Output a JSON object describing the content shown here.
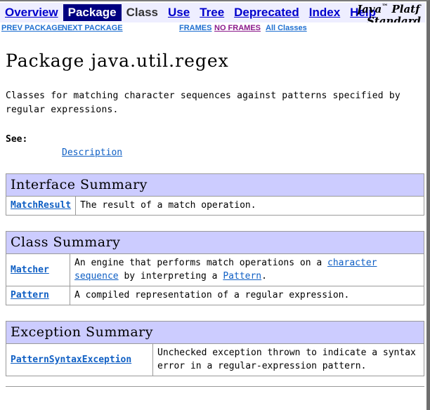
{
  "navbar": {
    "items": [
      {
        "label": "Overview",
        "state": "link"
      },
      {
        "label": "Package",
        "state": "current"
      },
      {
        "label": "Class",
        "state": "plain"
      },
      {
        "label": "Use",
        "state": "link"
      },
      {
        "label": "Tree",
        "state": "link"
      },
      {
        "label": "Deprecated",
        "state": "link"
      },
      {
        "label": "Index",
        "state": "link"
      },
      {
        "label": "Help",
        "state": "link"
      }
    ],
    "brand_line1": "Java",
    "brand_trademark": "™",
    "brand_line1_rest": " Platf",
    "brand_line2": "Standard E",
    "colors": {
      "nav_background": "#EEEEFF",
      "current_background": "#000080",
      "current_text": "#FFFFFF",
      "link": "#0000CC"
    }
  },
  "subnav": {
    "prev_package": "PREV PACKAGE",
    "next_package": "NEXT PACKAGE",
    "frames": "FRAMES",
    "no_frames": "NO FRAMES",
    "all_classes": "All Classes",
    "colors": {
      "link": "#1F6FD0",
      "visited": "#8B1A8B"
    }
  },
  "main": {
    "title": "Package java.util.regex",
    "description": "Classes for matching character sequences against patterns specified by regular expressions.",
    "see_label": "See:",
    "see_link": "Description"
  },
  "tables": [
    {
      "caption": "Interface Summary",
      "name_col_width": "narrow",
      "rows": [
        {
          "name": "MatchResult",
          "desc_parts": [
            {
              "text": "The result of a match operation.",
              "link": false
            }
          ]
        }
      ]
    },
    {
      "caption": "Class Summary",
      "name_col_width": "narrow",
      "rows": [
        {
          "name": "Matcher",
          "desc_parts": [
            {
              "text": "An engine that performs match operations on a ",
              "link": false
            },
            {
              "text": "character sequence",
              "link": true
            },
            {
              "text": " by interpreting a ",
              "link": false
            },
            {
              "text": "Pattern",
              "link": true
            },
            {
              "text": ".",
              "link": false
            }
          ]
        },
        {
          "name": "Pattern",
          "desc_parts": [
            {
              "text": "A compiled representation of a regular expression.",
              "link": false
            }
          ]
        }
      ]
    },
    {
      "caption": "Exception Summary",
      "name_col_width": "wide",
      "rows": [
        {
          "name": "PatternSyntaxException",
          "desc_parts": [
            {
              "text": "Unchecked exception thrown to indicate a syntax error in a regular-expression pattern.",
              "link": false
            }
          ]
        }
      ]
    }
  ],
  "colors": {
    "table_caption_background": "#CCCCFF",
    "table_border": "#9A9A9A",
    "page_background": "#FFFFFF",
    "link": "#0F5FC4"
  }
}
